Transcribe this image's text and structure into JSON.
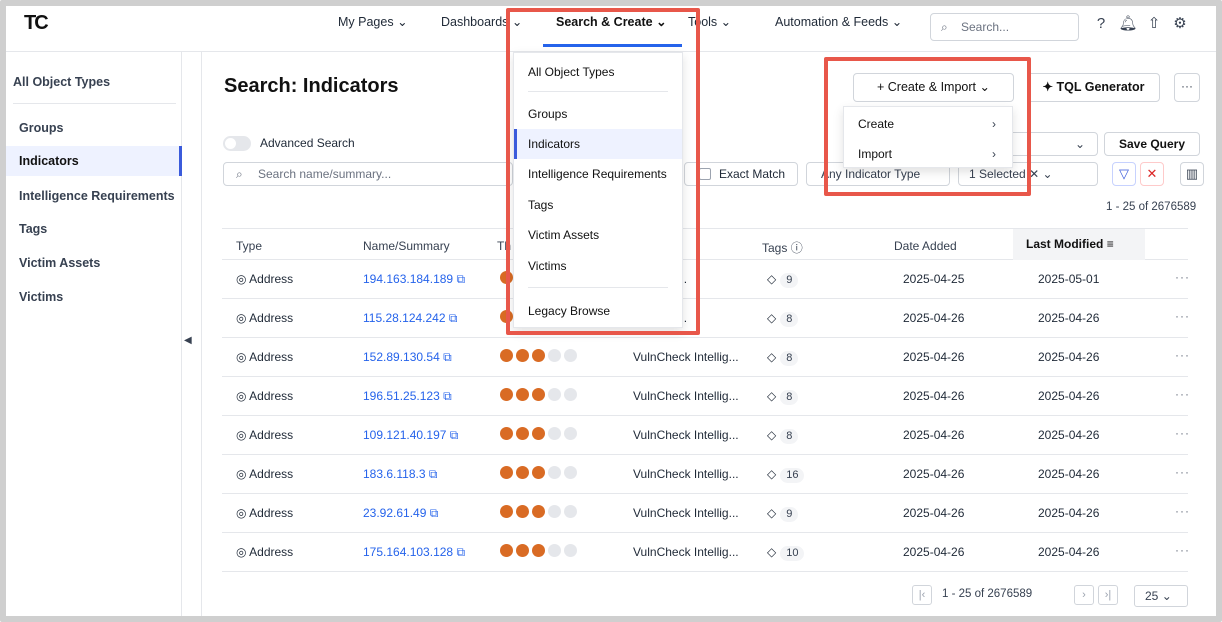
{
  "nav": {
    "logo": "TC",
    "items": [
      {
        "label": "My Pages",
        "chevron": "chevron-down-icon"
      },
      {
        "label": "Dashboards",
        "chevron": "chevron-down-icon"
      },
      {
        "label": "Search & Create",
        "chevron": "chevron-down-icon"
      },
      {
        "label": "Tools",
        "chevron": "chevron-down-icon"
      },
      {
        "label": "Automation & Feeds",
        "chevron": "chevron-down-icon"
      }
    ],
    "search_placeholder": "Search..."
  },
  "sidebar": {
    "header": "All Object Types",
    "items": [
      "Groups",
      "Indicators",
      "Intelligence Requirements",
      "Tags",
      "Victim Assets",
      "Victims"
    ],
    "selected": "Indicators"
  },
  "page": {
    "title": "Search: Indicators",
    "create_import": "Create & Import",
    "tql_generator": "TQL Generator",
    "advanced_search": "Advanced Search",
    "save_query": "Save Query",
    "search_placeholder": "Search name/summary...",
    "exact_match": "Exact Match",
    "indicator_type": "Any Indicator Type",
    "selected_filter": "1 Selected",
    "count_label": "1 - 25 of 2676589"
  },
  "search_menu": {
    "items": [
      "All Object Types",
      "Groups",
      "Indicators",
      "Intelligence Requirements",
      "Tags",
      "Victim Assets",
      "Victims",
      "Legacy Browse"
    ],
    "selected": "Indicators"
  },
  "create_menu": {
    "items": [
      "Create",
      "Import"
    ]
  },
  "table": {
    "columns": [
      "Type",
      "Name/Summary",
      "Th",
      "",
      "Tags",
      "Date Added",
      "Last Modified"
    ],
    "rows": [
      {
        "type": "Address",
        "name": "194.163.184.189",
        "threat": 3,
        "source": "k Intellig...",
        "tags": "9",
        "added": "2025-04-25",
        "modified": "2025-05-01"
      },
      {
        "type": "Address",
        "name": "115.28.124.242",
        "threat": 3,
        "source": "k Intellig...",
        "tags": "8",
        "added": "2025-04-26",
        "modified": "2025-04-26"
      },
      {
        "type": "Address",
        "name": "152.89.130.54",
        "threat": 3,
        "source": "VulnCheck Intellig...",
        "tags": "8",
        "added": "2025-04-26",
        "modified": "2025-04-26"
      },
      {
        "type": "Address",
        "name": "196.51.25.123",
        "threat": 3,
        "source": "VulnCheck Intellig...",
        "tags": "8",
        "added": "2025-04-26",
        "modified": "2025-04-26"
      },
      {
        "type": "Address",
        "name": "109.121.40.197",
        "threat": 3,
        "source": "VulnCheck Intellig...",
        "tags": "8",
        "added": "2025-04-26",
        "modified": "2025-04-26"
      },
      {
        "type": "Address",
        "name": "183.6.118.3",
        "threat": 3,
        "source": "VulnCheck Intellig...",
        "tags": "16",
        "added": "2025-04-26",
        "modified": "2025-04-26"
      },
      {
        "type": "Address",
        "name": "23.92.61.49",
        "threat": 3,
        "source": "VulnCheck Intellig...",
        "tags": "9",
        "added": "2025-04-26",
        "modified": "2025-04-26"
      },
      {
        "type": "Address",
        "name": "175.164.103.128",
        "threat": 3,
        "source": "VulnCheck Intellig...",
        "tags": "10",
        "added": "2025-04-26",
        "modified": "2025-04-26"
      }
    ],
    "threat_max": 5
  },
  "pager": {
    "label": "1 - 25 of 2676589",
    "page_size": "25"
  },
  "colors": {
    "accent": "#2563eb",
    "threat": "#d96b24",
    "highlight": "#e8574a"
  }
}
